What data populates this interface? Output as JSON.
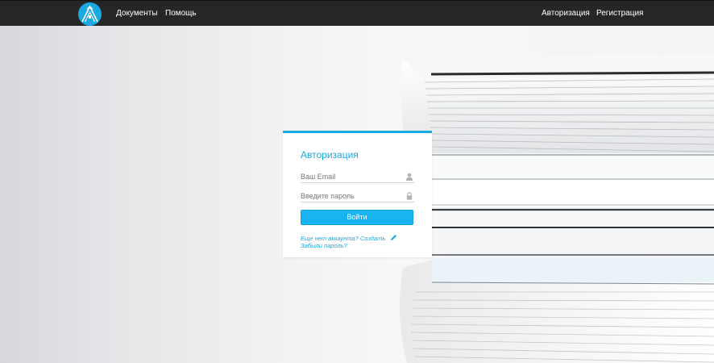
{
  "navbar": {
    "logo": "site-logo-icon",
    "links_left": {
      "documents": "Документы",
      "help": "Помощь"
    },
    "links_right": {
      "login": "Авторизация",
      "register": "Регистрация"
    },
    "background_color": "#262626"
  },
  "login_form": {
    "title": "Авторизация",
    "email_placeholder": "Ваш Email",
    "email_icon": "user-icon",
    "password_placeholder": "Введите пароль",
    "password_icon": "lock-icon",
    "submit_label": "Войти",
    "no_account_text": "Еще нет аккаунта?",
    "create_link": "Создать",
    "create_icon": "pencil-icon",
    "forgot_link": "Забыли пароль?",
    "accent_color": "#19a9e3"
  }
}
